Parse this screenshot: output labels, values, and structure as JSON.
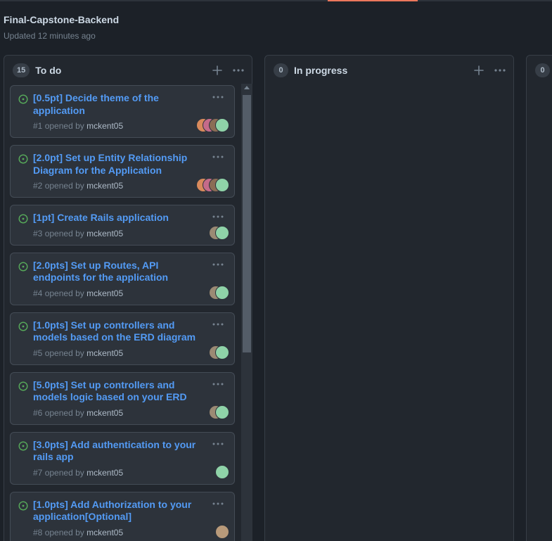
{
  "project": {
    "title": "Final-Capstone-Backend",
    "updated": "Updated 12 minutes ago"
  },
  "icons": {
    "add": "plus-icon",
    "menu": "kebab-horizontal-icon",
    "issue": "issue-opened-icon"
  },
  "colors": {
    "accent": "#ec775c",
    "link": "#539bf5",
    "open": "#57ab5a"
  },
  "columns": [
    {
      "name": "To do",
      "count": "15",
      "cards": [
        {
          "title": "[0.5pt] Decide theme of the application",
          "number": "#1",
          "opened_by": "opened by",
          "author": "mckent05",
          "avatars": [
            "#d98a5c",
            "#c56b8a",
            "#8b6d55",
            "#8fd3a8"
          ]
        },
        {
          "title": "[2.0pt] Set up Entity Relationship Diagram for the Application",
          "number": "#2",
          "opened_by": "opened by",
          "author": "mckent05",
          "avatars": [
            "#d98a5c",
            "#c56b8a",
            "#8b6d55",
            "#8fd3a8"
          ]
        },
        {
          "title": "[1pt] Create Rails application",
          "number": "#3",
          "opened_by": "opened by",
          "author": "mckent05",
          "avatars": [
            "#9b8a74",
            "#8fd3a8"
          ]
        },
        {
          "title": "[2.0pts] Set up Routes, API endpoints for the application",
          "number": "#4",
          "opened_by": "opened by",
          "author": "mckent05",
          "avatars": [
            "#9b8a74",
            "#8fd3a8"
          ]
        },
        {
          "title": "[1.0pts] Set up controllers and models based on the ERD diagram",
          "number": "#5",
          "opened_by": "opened by",
          "author": "mckent05",
          "avatars": [
            "#9b8a74",
            "#8fd3a8"
          ]
        },
        {
          "title": "[5.0pts] Set up controllers and models logic based on your ERD",
          "number": "#6",
          "opened_by": "opened by",
          "author": "mckent05",
          "avatars": [
            "#9b8a74",
            "#8fd3a8"
          ]
        },
        {
          "title": "[3.0pts] Add authentication to your rails app",
          "number": "#7",
          "opened_by": "opened by",
          "author": "mckent05",
          "avatars": [
            "#8fd3a8"
          ]
        },
        {
          "title": "[1.0pts] Add Authorization to your application[Optional]",
          "number": "#8",
          "opened_by": "opened by",
          "author": "mckent05",
          "avatars": [
            "#b89a7a"
          ]
        }
      ]
    },
    {
      "name": "In progress",
      "count": "0",
      "cards": []
    },
    {
      "name": "",
      "count": "0",
      "cards": []
    }
  ]
}
